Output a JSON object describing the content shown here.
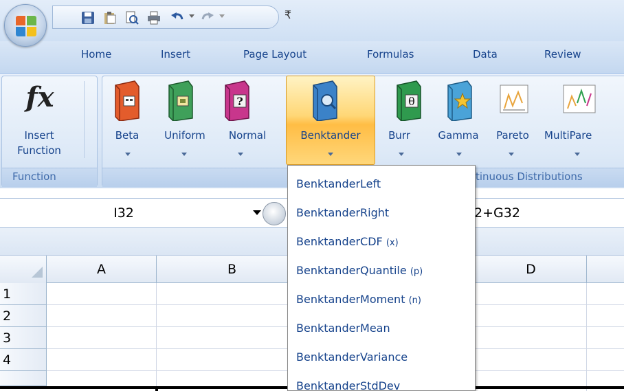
{
  "qat": {
    "icons": [
      "save-icon",
      "paste-icon",
      "print-preview-icon",
      "quick-print-icon",
      "undo-icon",
      "redo-icon",
      "customize-qat-icon"
    ],
    "customize_glyph": "₹"
  },
  "tabs": [
    {
      "label": "Home"
    },
    {
      "label": "Insert"
    },
    {
      "label": "Page Layout"
    },
    {
      "label": "Formulas"
    },
    {
      "label": "Data"
    },
    {
      "label": "Review"
    }
  ],
  "ribbon": {
    "function_group": {
      "icon_text": "fx",
      "insert_function_label_line1": "Insert",
      "insert_function_label_line2": "Function",
      "group_label": "Function"
    },
    "distributions": [
      {
        "label": "Beta",
        "icon": "beta-book-icon",
        "color": "#e35c2c"
      },
      {
        "label": "Uniform",
        "icon": "uniform-book-icon",
        "color": "#3fa05a"
      },
      {
        "label": "Normal",
        "icon": "normal-book-icon",
        "color": "#c8368c"
      },
      {
        "label": "Benktander",
        "icon": "benktander-book-icon",
        "color": "#3b82c8"
      },
      {
        "label": "Burr",
        "icon": "burr-book-icon",
        "color": "#2f9a4e"
      },
      {
        "label": "Gamma",
        "icon": "gamma-book-icon",
        "color": "#4aa3d8"
      },
      {
        "label": "Pareto",
        "icon": "pareto-chart-icon",
        "color": "#e8a43c"
      },
      {
        "label": "MultiPare",
        "icon": "multipareto-chart-icon",
        "color": "#2fa04f"
      }
    ],
    "distributions_group_label": "tinuous Distributions",
    "burr_glyph": "θ",
    "normal_glyph": "?"
  },
  "formula_bar": {
    "name_box": "I32",
    "formula": "2+G32"
  },
  "grid": {
    "columns": [
      "A",
      "B",
      "D"
    ],
    "rows": [
      "1",
      "2",
      "3",
      "4"
    ]
  },
  "dropdown": {
    "items": [
      {
        "name": "BenktanderLeft",
        "arg": ""
      },
      {
        "name": "BenktanderRight",
        "arg": ""
      },
      {
        "name": "BenktanderCDF",
        "arg": "(x)"
      },
      {
        "name": "BenktanderQuantile",
        "arg": "(p)"
      },
      {
        "name": "BenktanderMoment",
        "arg": "(n)"
      },
      {
        "name": "BenktanderMean",
        "arg": ""
      },
      {
        "name": "BenktanderVariance",
        "arg": ""
      },
      {
        "name": "BenktanderStdDev",
        "arg": ""
      }
    ]
  }
}
